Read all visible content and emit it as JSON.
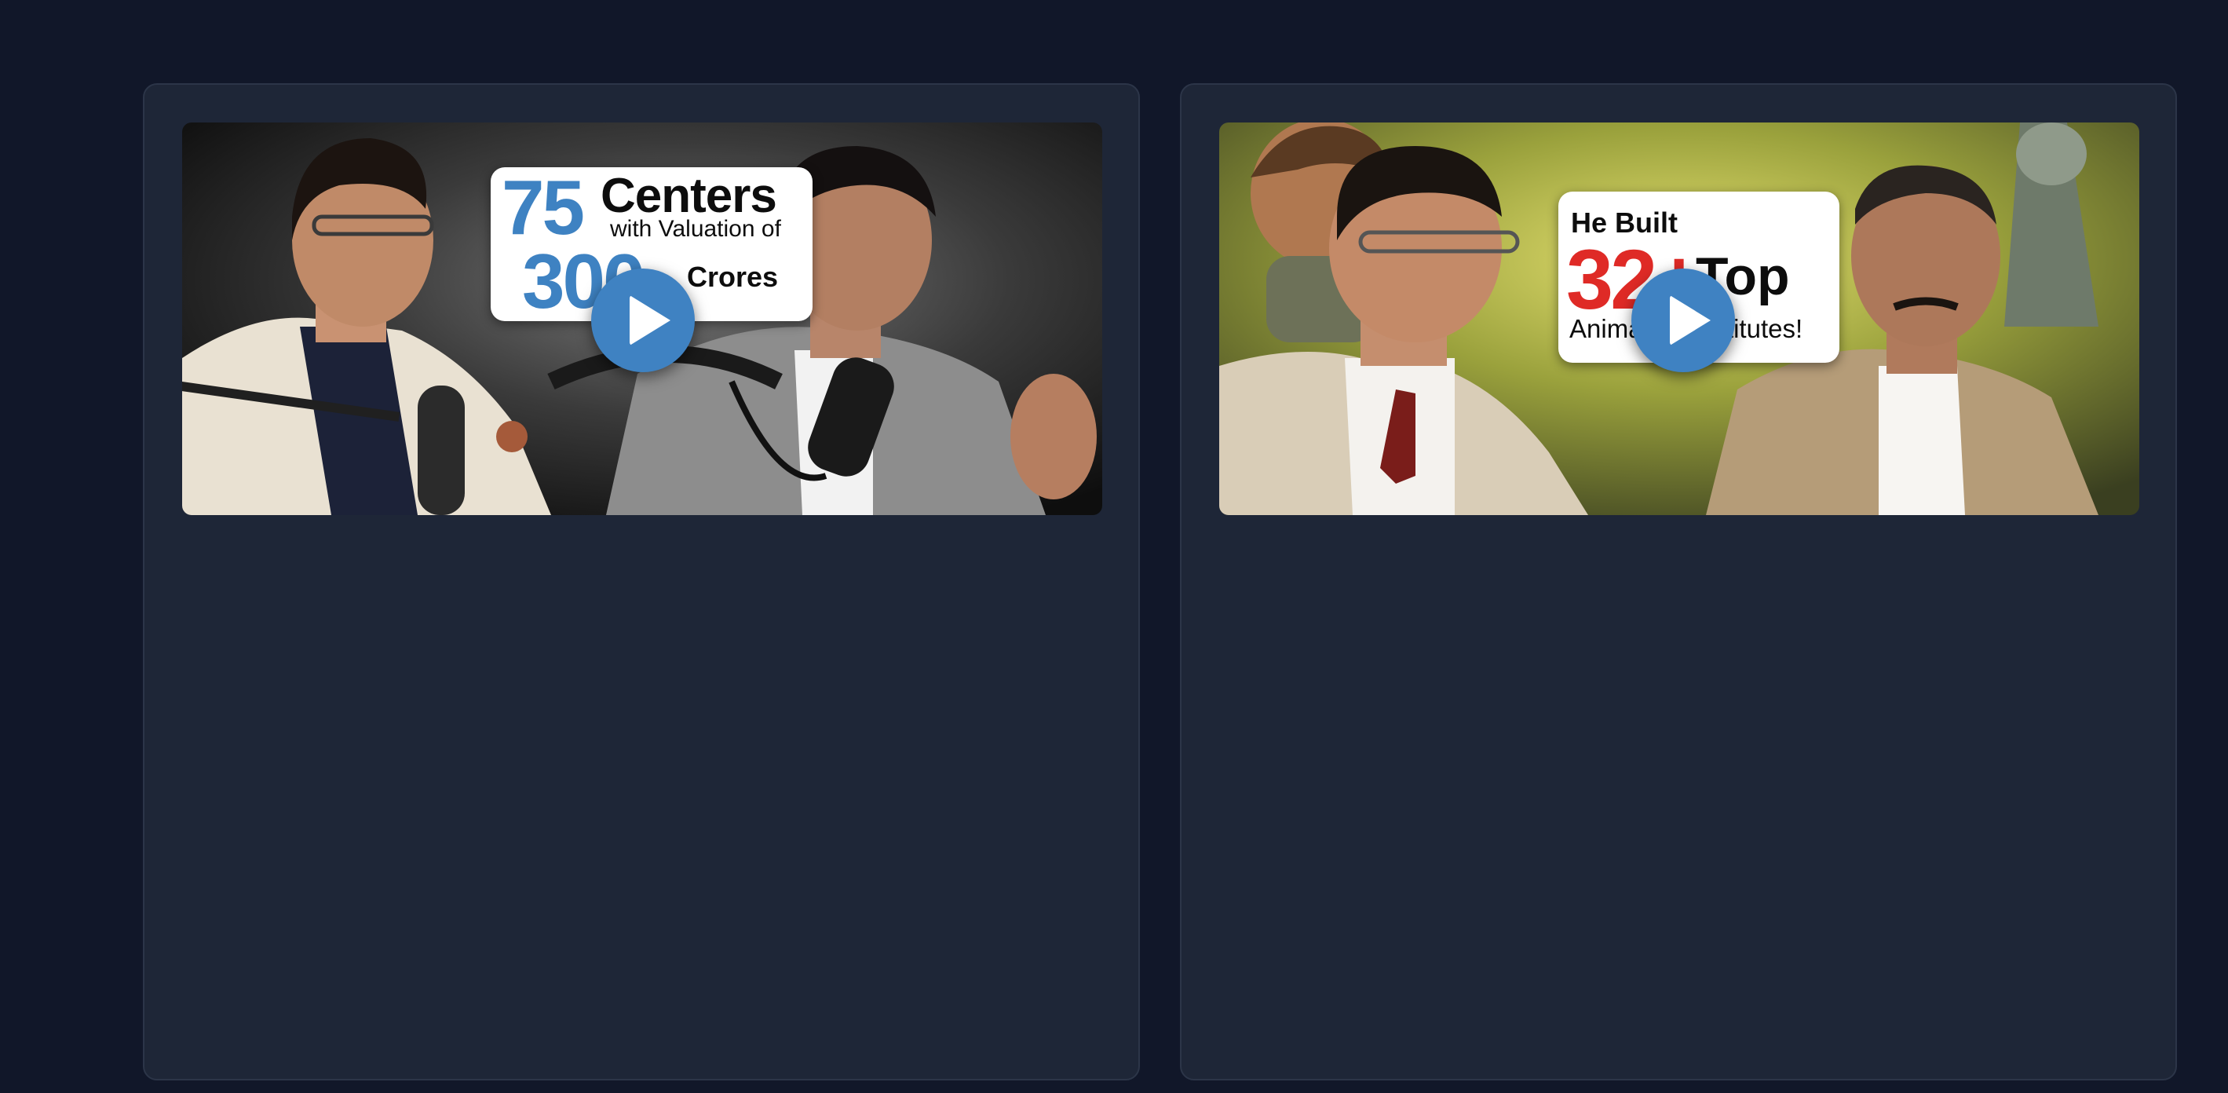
{
  "videos": [
    {
      "thumbnail_text": {
        "number_top": "75",
        "word_top": "Centers",
        "line_mid": "with Valuation of",
        "number_bottom": "300",
        "word_bottom": "Crores"
      },
      "play_icon": "play-icon"
    },
    {
      "thumbnail_text": {
        "line_top": "He Built",
        "number": "32+",
        "word": "Top",
        "line_bottom": "Animation Institutes!"
      },
      "play_icon": "play-icon"
    }
  ],
  "colors": {
    "page_background": "#111729",
    "card_background": "#1e2637",
    "play_button": "#3f82c2",
    "accent_blue": "#3e82c2",
    "accent_red": "#df2a26"
  }
}
